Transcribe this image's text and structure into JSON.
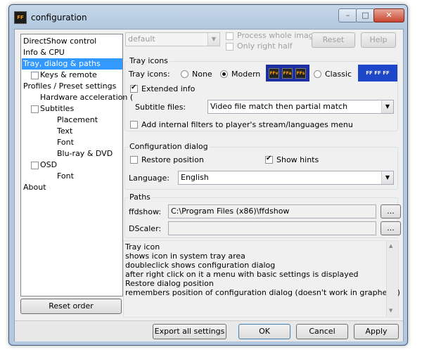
{
  "window": {
    "title": "configuration",
    "app_icon": "ffdshow-icon",
    "minimize": "–",
    "maximize": "□",
    "close": "✕"
  },
  "tree": {
    "items": [
      {
        "label": "DirectShow control"
      },
      {
        "label": "Info & CPU"
      },
      {
        "label": "Tray, dialog & paths",
        "selected": true
      },
      {
        "label": "Keys & remote"
      },
      {
        "label": "Profiles / Preset settings"
      },
      {
        "label": "Hardware acceleration ("
      },
      {
        "label": "Subtitles"
      },
      {
        "label": "Placement"
      },
      {
        "label": "Text"
      },
      {
        "label": "Font"
      },
      {
        "label": "Blu-ray & DVD"
      },
      {
        "label": "OSD"
      },
      {
        "label": "Font"
      },
      {
        "label": "About"
      }
    ],
    "reset_order": "Reset order"
  },
  "top": {
    "preset_value": "default",
    "process_whole_image": "Process whole image",
    "only_right_half": "Only right half",
    "reset": "Reset",
    "help": "Help"
  },
  "tray_icons": {
    "group_title": "Tray icons",
    "label": "Tray icons:",
    "none": "None",
    "modern": "Modern",
    "classic": "Classic",
    "selected": "Modern",
    "extended_info": "Extended info",
    "subtitle_files_label": "Subtitle files:",
    "subtitle_files_value": "Video file match then partial match",
    "add_internal_filters": "Add internal filters to player's stream/languages menu"
  },
  "config_dialog": {
    "group_title": "Configuration dialog",
    "restore_position": "Restore position",
    "show_hints": "Show hints",
    "language_label": "Language:",
    "language_value": "English"
  },
  "paths": {
    "group_title": "Paths",
    "ffdshow_label": "ffdshow:",
    "ffdshow_value": "C:\\Program Files (x86)\\ffdshow",
    "dscaler_label": "DScaler:",
    "dscaler_value": "",
    "browse": "..."
  },
  "help_text": [
    "Tray icon",
    "   shows icon in system tray area",
    "   doubleclick shows configuration dialog",
    "   after right click on it a menu with basic settings is displayed",
    "Restore dialog position",
    "   remembers position of configuration dialog (doesn't work in graphedit)"
  ],
  "buttons": {
    "export": "Export all settings",
    "ok": "OK",
    "cancel": "Cancel",
    "apply": "Apply"
  },
  "icon_text": {
    "ffa": "FFa",
    "ffv": "FFv",
    "ffs": "FFs"
  }
}
